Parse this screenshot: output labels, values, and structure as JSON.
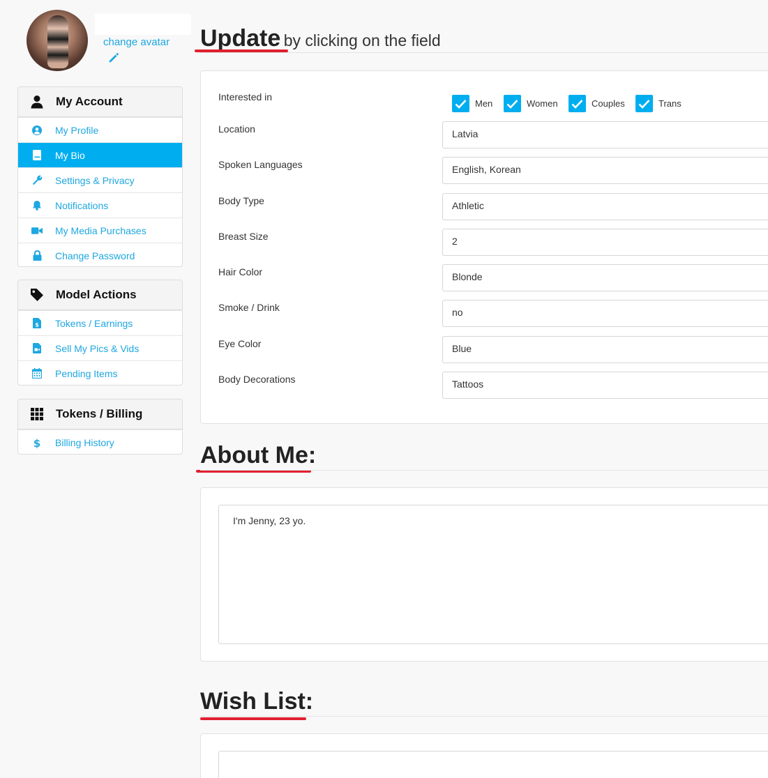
{
  "profile": {
    "change_avatar_label": "change avatar"
  },
  "sidebar": {
    "account": {
      "title": "My Account",
      "items": [
        {
          "label": "My Profile",
          "icon": "user-circle-icon"
        },
        {
          "label": "My Bio",
          "icon": "book-icon",
          "active": true
        },
        {
          "label": "Settings & Privacy",
          "icon": "wrench-icon"
        },
        {
          "label": "Notifications",
          "icon": "bell-icon"
        },
        {
          "label": "My Media Purchases",
          "icon": "video-camera-icon"
        },
        {
          "label": "Change Password",
          "icon": "lock-icon"
        }
      ]
    },
    "model": {
      "title": "Model Actions",
      "items": [
        {
          "label": "Tokens / Earnings",
          "icon": "dollar-file-icon"
        },
        {
          "label": "Sell My Pics & Vids",
          "icon": "video-file-icon"
        },
        {
          "label": "Pending Items",
          "icon": "calendar-icon"
        }
      ]
    },
    "billing": {
      "title": "Tokens / Billing",
      "items": [
        {
          "label": "Billing History",
          "icon": "dollar-icon"
        }
      ]
    }
  },
  "update": {
    "title": "Update",
    "subtitle": "by clicking on the field"
  },
  "form": {
    "interested_label": "Interested in",
    "interested_options": [
      {
        "label": "Men",
        "checked": true
      },
      {
        "label": "Women",
        "checked": true
      },
      {
        "label": "Couples",
        "checked": true
      },
      {
        "label": "Trans",
        "checked": true
      }
    ],
    "fields": [
      {
        "label": "Location",
        "value": "Latvia"
      },
      {
        "label": "Spoken Languages",
        "value": "English, Korean"
      },
      {
        "label": "Body Type",
        "value": "Athletic"
      },
      {
        "label": "Breast Size",
        "value": "2"
      },
      {
        "label": "Hair Color",
        "value": "Blonde"
      },
      {
        "label": "Smoke / Drink",
        "value": "no"
      },
      {
        "label": "Eye Color",
        "value": "Blue"
      },
      {
        "label": "Body Decorations",
        "value": "Tattoos"
      }
    ]
  },
  "about": {
    "title": "About Me:",
    "text": "I'm Jenny, 23 yo."
  },
  "wishlist": {
    "title": "Wish List:",
    "text": ""
  },
  "colors": {
    "accent": "#00aef0",
    "link": "#1ea7e1",
    "underline": "#e0202f"
  }
}
